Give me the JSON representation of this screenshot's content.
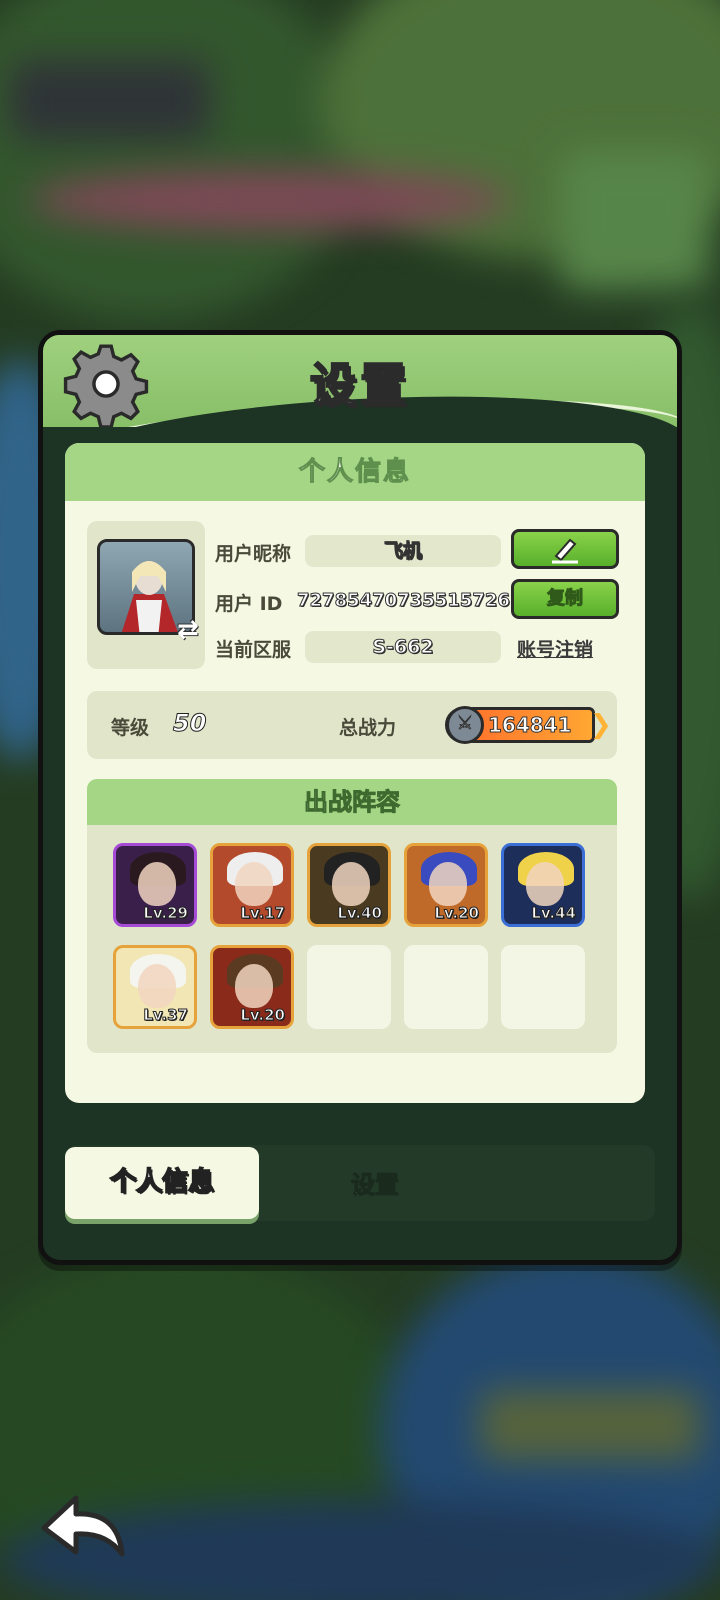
{
  "dialog": {
    "title": "设置",
    "gear_icon": "gear-icon"
  },
  "profile_card": {
    "header": "个人信息",
    "nickname_label": "用户昵称",
    "nickname_value": "飞机",
    "edit_icon": "pencil-icon",
    "uid_label": "用户 ID",
    "uid_value": "72785470735515726",
    "copy_label": "复制",
    "server_label": "当前区服",
    "server_value": "S-662",
    "cancel_account_label": "账号注销",
    "level_label": "等级",
    "level_value": "50",
    "power_label": "总战力",
    "power_value": "164841"
  },
  "lineup": {
    "header": "出战阵容",
    "heroes": [
      {
        "level": "Lv.29",
        "rarity_color": "#a64bd6",
        "bg": "#3a1f4a",
        "hair": "#2a1a20"
      },
      {
        "level": "Lv.17",
        "rarity_color": "#e6a33b",
        "bg": "#b34a2c",
        "hair": "#eeeeee"
      },
      {
        "level": "Lv.40",
        "rarity_color": "#e6a33b",
        "bg": "#4a3a20",
        "hair": "#222222"
      },
      {
        "level": "Lv.20",
        "rarity_color": "#e6a33b",
        "bg": "#c06a2a",
        "hair": "#3a4bc0"
      },
      {
        "level": "Lv.44",
        "rarity_color": "#3b6fd6",
        "bg": "#1e2e5a",
        "hair": "#f0d24a"
      },
      {
        "level": "Lv.37",
        "rarity_color": "#e6a33b",
        "bg": "#f1e6b4",
        "hair": "#f5f5f0"
      },
      {
        "level": "Lv.20",
        "rarity_color": "#e6a33b",
        "bg": "#8a2a1a",
        "hair": "#5a3a20"
      }
    ],
    "empty_slots": 3
  },
  "tabs": {
    "active": "个人信息",
    "inactive": "设置"
  },
  "back_icon": "back-arrow-icon"
}
